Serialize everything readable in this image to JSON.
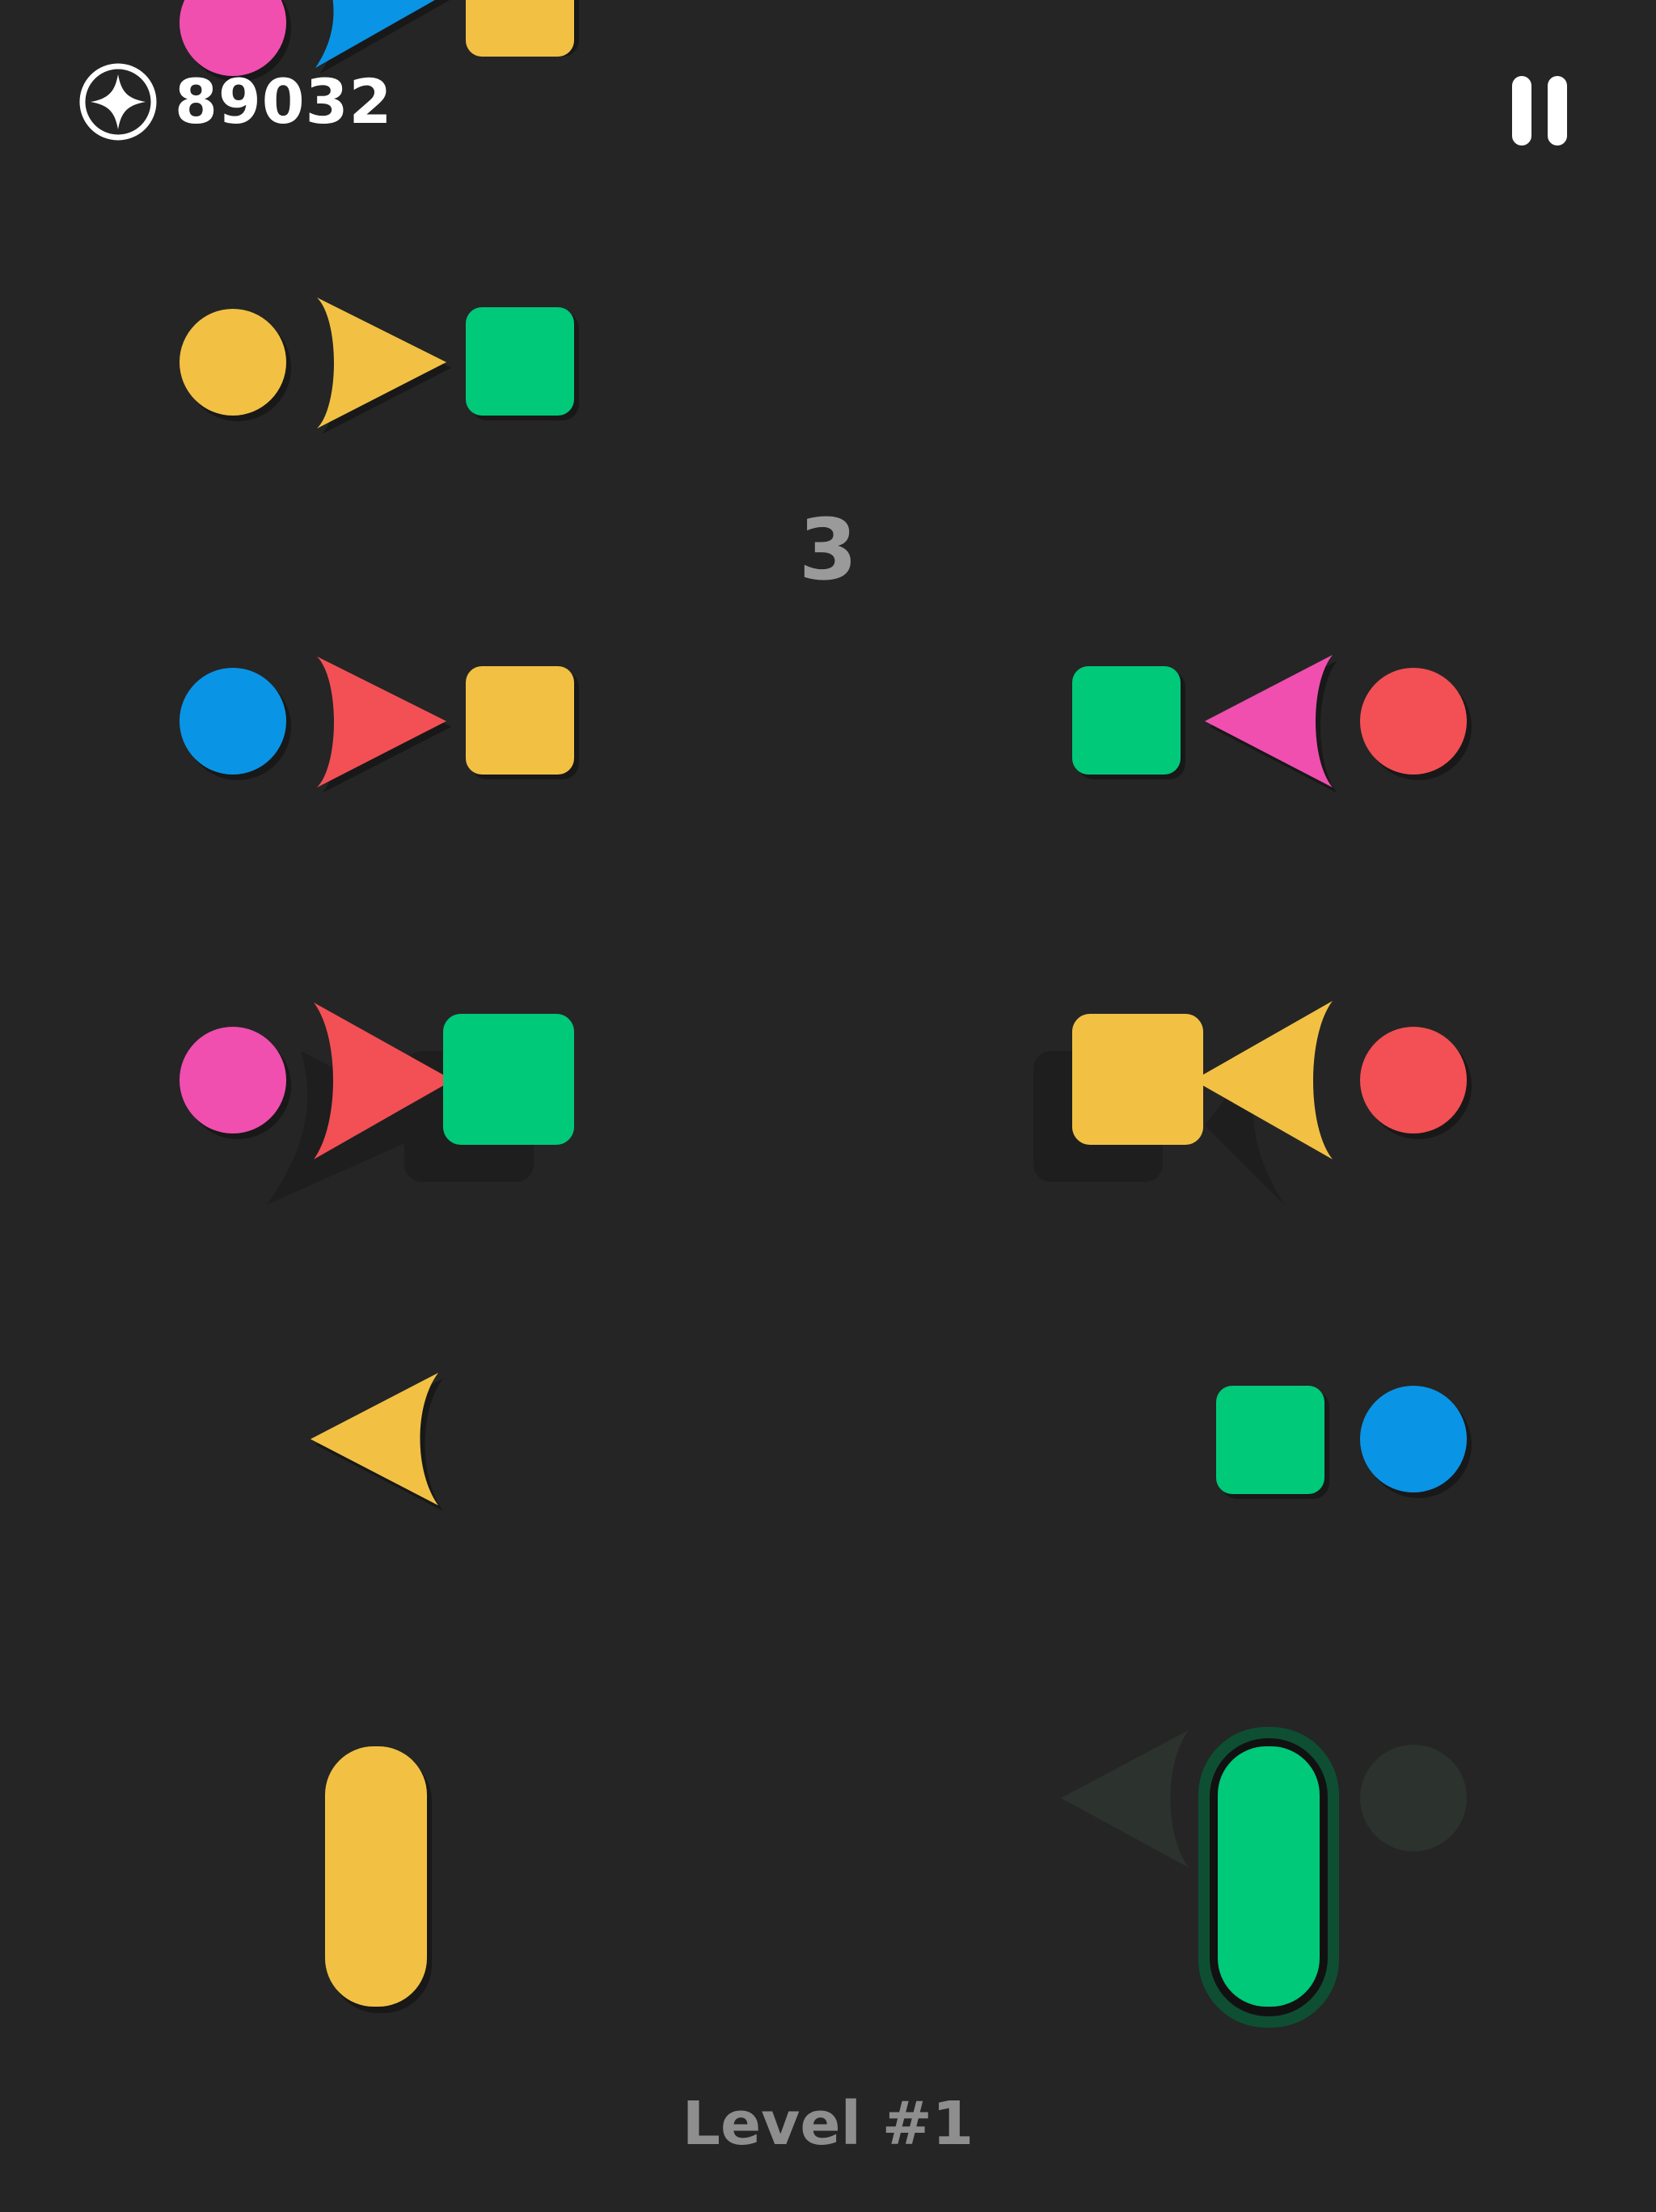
{
  "hud": {
    "score": "89032",
    "score_icon": "star-coin-icon",
    "pause_icon": "pause-icon"
  },
  "counter": "3",
  "level": "Level #1",
  "colors": {
    "background": "#252525",
    "pink": "#F04FB0",
    "blue": "#0A94E6",
    "yellow": "#F2C144",
    "green": "#00C97A",
    "red": "#F25055",
    "shadow": "#181818",
    "ghost": "#2C322E",
    "selected_outline": "#0E4F33"
  },
  "shapes_left_column": [
    [
      "pink circle",
      "blue arrow",
      "yellow square"
    ],
    [
      "yellow circle",
      "yellow arrow",
      "green square"
    ],
    [
      "blue circle",
      "red arrow",
      "yellow square"
    ],
    [
      "pink circle",
      "red arrow",
      "green square"
    ],
    [
      "yellow arrow"
    ]
  ],
  "shapes_right_column": [
    [
      "green square",
      "pink arrow",
      "red circle"
    ],
    [
      "yellow square",
      "yellow arrow",
      "red circle"
    ],
    [
      "green square",
      "blue circle"
    ]
  ],
  "paddles": [
    {
      "lane": "left",
      "color": "yellow",
      "selected": false
    },
    {
      "lane": "right",
      "color": "green",
      "selected": true
    }
  ]
}
